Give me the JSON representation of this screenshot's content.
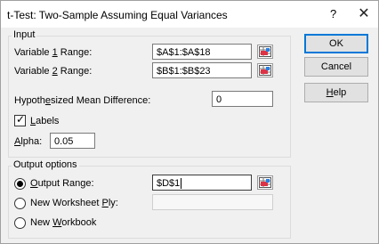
{
  "dialog": {
    "title": "t-Test: Two-Sample Assuming Equal Variances",
    "help_glyph": "?",
    "close_glyph": "✕"
  },
  "input_group": {
    "label": "Input",
    "var1": {
      "label_pre": "Variable ",
      "label_key": "1",
      "label_post": " Range:",
      "value": "$A$1:$A$18"
    },
    "var2": {
      "label_pre": "Variable ",
      "label_key": "2",
      "label_post": " Range:",
      "value": "$B$1:$B$23"
    },
    "hyp": {
      "label_pre": "Hypoth",
      "label_key": "e",
      "label_post": "sized Mean Difference:",
      "value": "0"
    },
    "labels": {
      "label_key": "L",
      "label_post": "abels",
      "checked": true
    },
    "alpha": {
      "label_key": "A",
      "label_post": "lpha:",
      "value": "0.05"
    }
  },
  "output_group": {
    "label": "Output options",
    "output_range": {
      "label_key": "O",
      "label_post": "utput Range:",
      "value": "$D$1",
      "selected": true
    },
    "new_ply": {
      "label_pre": "New Worksheet ",
      "label_key": "P",
      "label_post": "ly:",
      "value": "",
      "selected": false
    },
    "new_workbook": {
      "label_pre": "New ",
      "label_key": "W",
      "label_post": "orkbook",
      "selected": false
    }
  },
  "buttons": {
    "ok": "OK",
    "cancel": "Cancel",
    "help_key": "H",
    "help_post": "elp"
  },
  "icons": {
    "range_picker": "range-picker-icon",
    "accent": "#0078d7"
  }
}
